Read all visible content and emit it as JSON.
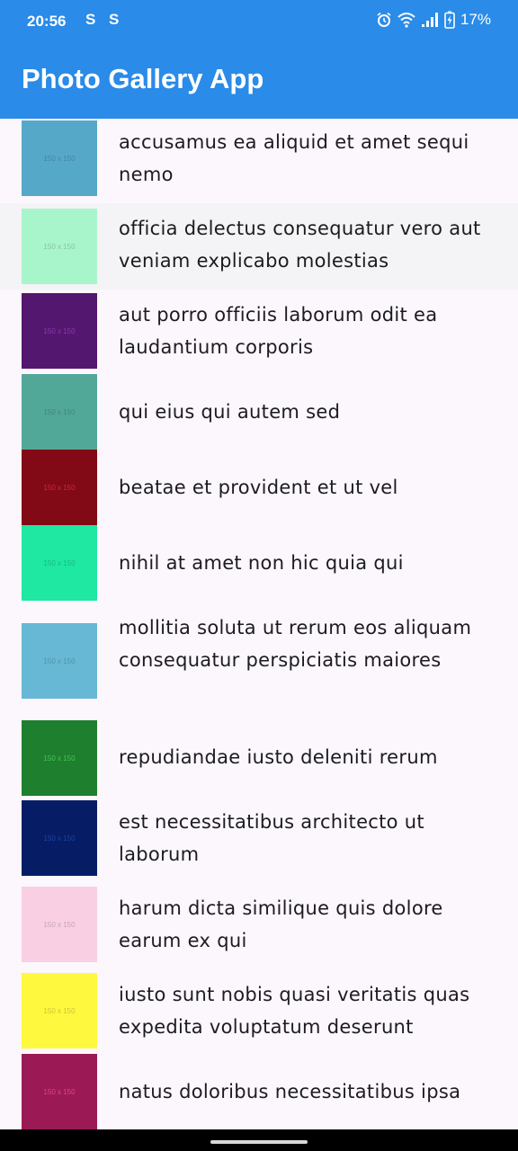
{
  "status_bar": {
    "time": "20:56",
    "notification_icons": [
      "S",
      "S"
    ],
    "battery_percent": "17%",
    "icons": [
      "alarm-icon",
      "wifi-icon",
      "signal-icon",
      "battery-charging-icon"
    ]
  },
  "app_bar": {
    "title": "Photo Gallery App",
    "color": "#2a8be8"
  },
  "photos": [
    {
      "title": "accusamus ea aliquid et amet sequi nemo",
      "thumb_label": "150 x 150",
      "color": "#56a8c8"
    },
    {
      "title": "officia delectus consequatur vero aut veniam explicabo molestias",
      "thumb_label": "150 x 150",
      "color": "#a8f5cc"
    },
    {
      "title": "aut porro officiis laborum odit ea laudantium corporis",
      "thumb_label": "150 x 150",
      "color": "#54176f"
    },
    {
      "title": "qui eius qui autem sed",
      "thumb_label": "150 x 150",
      "color": "#51a898"
    },
    {
      "title": "beatae et provident et ut vel",
      "thumb_label": "150 x 150",
      "color": "#820a16"
    },
    {
      "title": "nihil at amet non hic quia qui",
      "thumb_label": "150 x 150",
      "color": "#1ee8a2"
    },
    {
      "title": "mollitia soluta ut rerum eos aliquam consequatur perspiciatis maiores",
      "thumb_label": "150 x 150",
      "color": "#66b8d4"
    },
    {
      "title": "repudiandae iusto deleniti rerum",
      "thumb_label": "150 x 150",
      "color": "#1e7f2e"
    },
    {
      "title": "est necessitatibus architecto ut laborum",
      "thumb_label": "150 x 150",
      "color": "#061d66"
    },
    {
      "title": "harum dicta similique quis dolore earum ex qui",
      "thumb_label": "150 x 150",
      "color": "#f8cfe3"
    },
    {
      "title": "iusto sunt nobis quasi veritatis quas expedita voluptatum deserunt",
      "thumb_label": "150 x 150",
      "color": "#fef83e"
    },
    {
      "title": "natus doloribus necessitatibus ipsa",
      "thumb_label": "150 x 150",
      "color": "#9b1a55"
    }
  ]
}
